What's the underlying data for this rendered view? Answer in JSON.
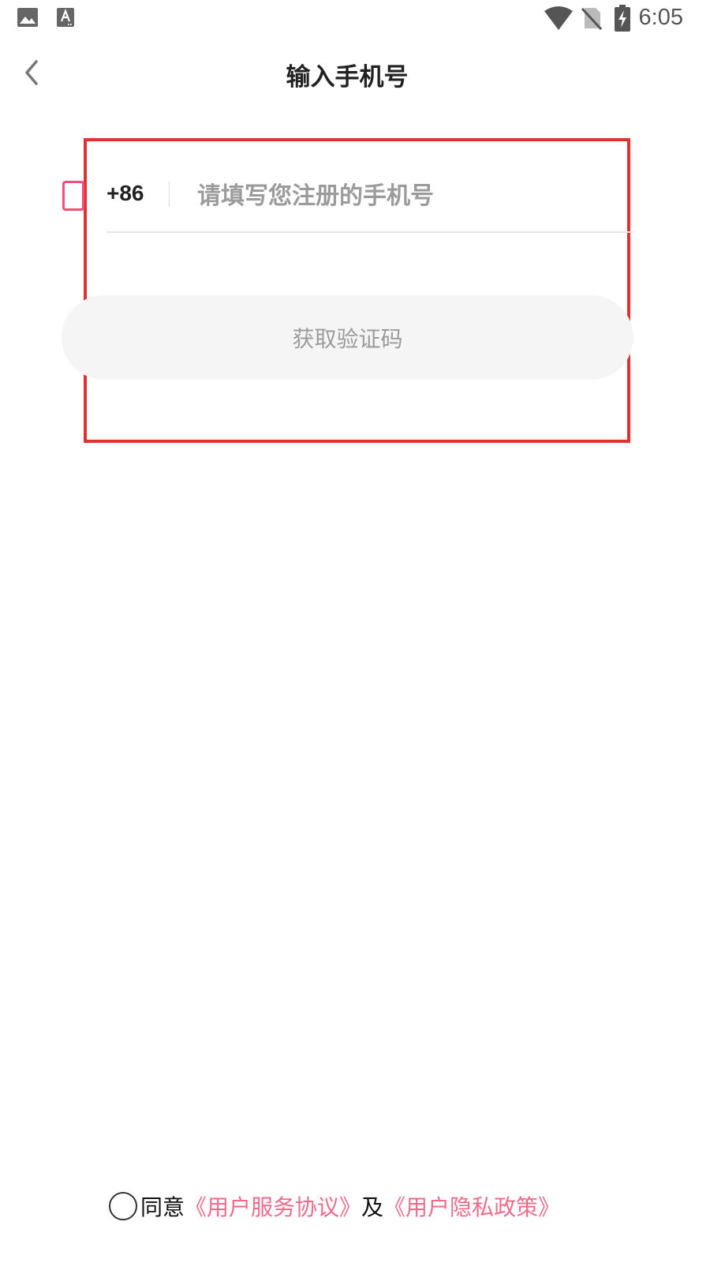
{
  "status_bar": {
    "time": "6:05",
    "icons": [
      "image-icon",
      "text-icon",
      "wifi-icon",
      "no-sim-icon",
      "battery-charging-icon"
    ]
  },
  "header": {
    "title": "输入手机号",
    "back_icon": "chevron-left-icon"
  },
  "phone": {
    "country_code": "+86",
    "placeholder": "请填写您注册的手机号",
    "value": ""
  },
  "get_code_button": {
    "label": "获取验证码"
  },
  "agreement": {
    "prefix": "同意",
    "terms_link": "《用户服务协议》",
    "connector": "及",
    "privacy_link": "《用户隐私政策》",
    "checked": false
  },
  "colors": {
    "accent": "#f06b8a",
    "highlight": "#e03030",
    "button_bg": "#f5f5f5"
  }
}
